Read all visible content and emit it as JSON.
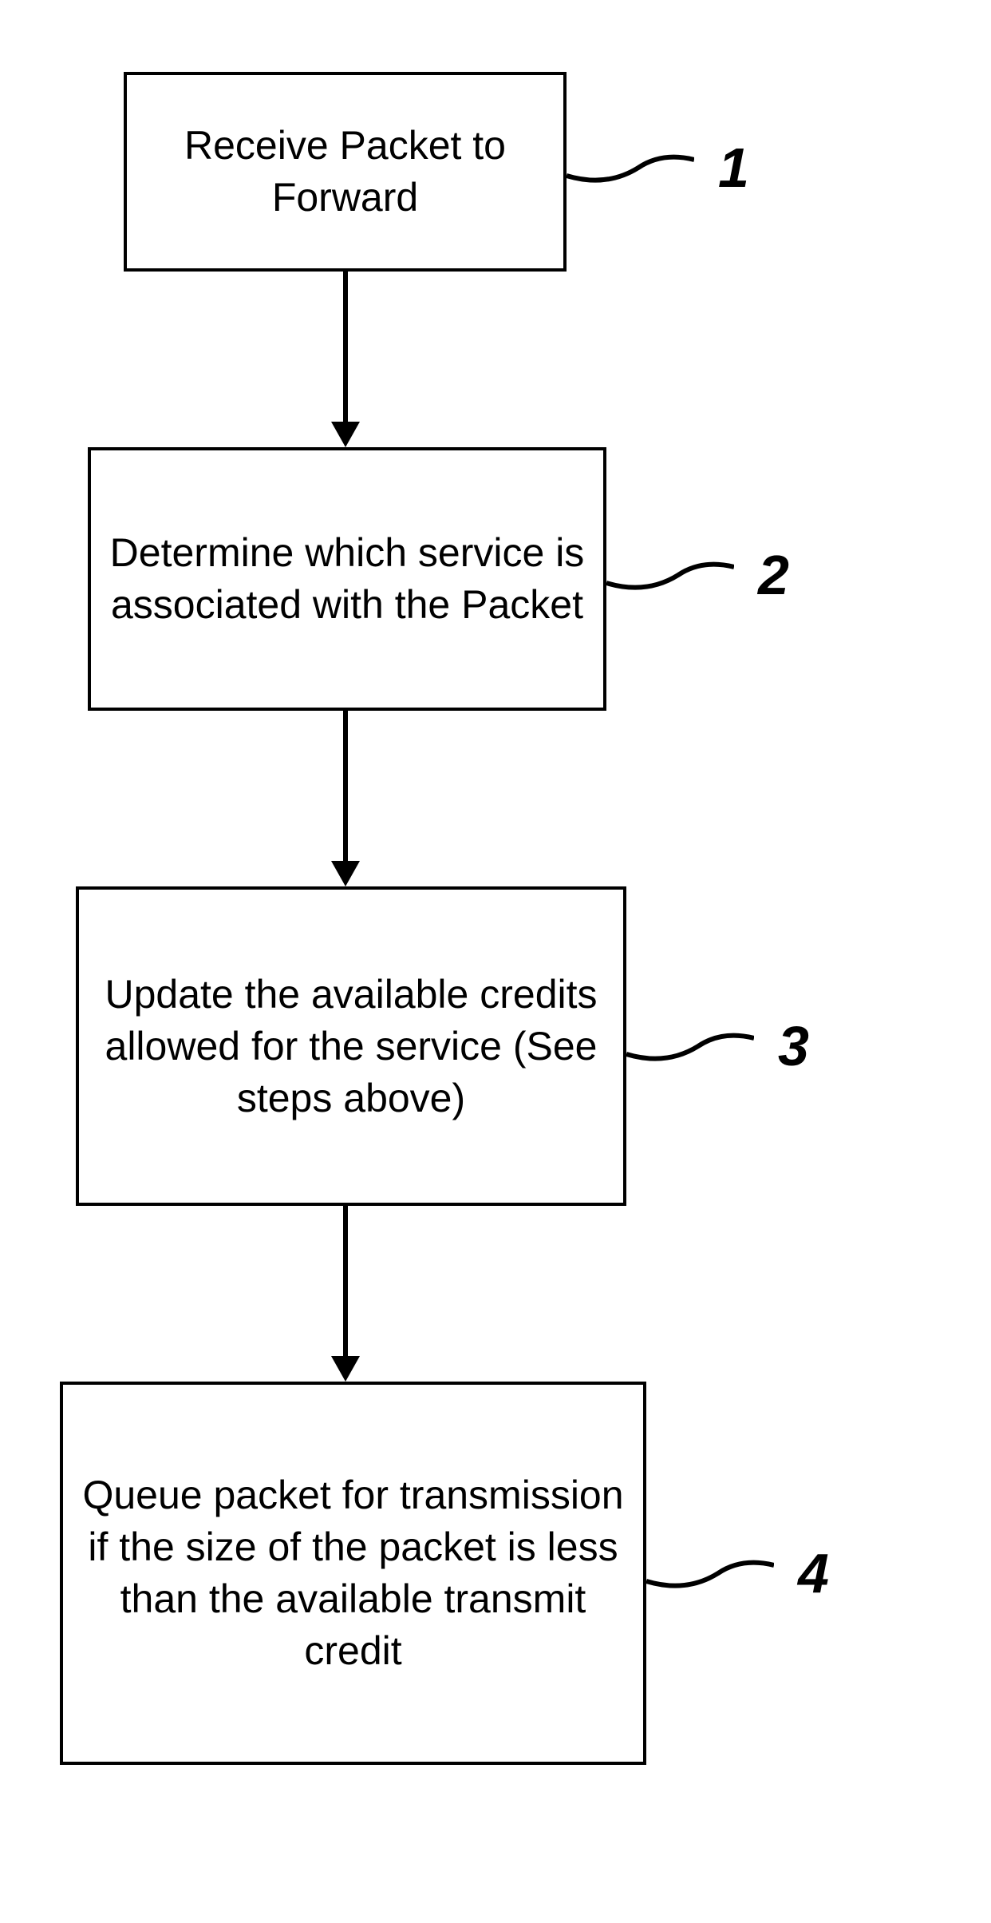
{
  "flowchart": {
    "boxes": [
      {
        "text": "Receive Packet to Forward",
        "label": "1"
      },
      {
        "text": "Determine which service is associated with the Packet",
        "label": "2"
      },
      {
        "text": "Update the available credits allowed for the service (See steps above)",
        "label": "3"
      },
      {
        "text": "Queue packet for transmission if the size of the packet is less than the available transmit credit",
        "label": "4"
      }
    ]
  }
}
